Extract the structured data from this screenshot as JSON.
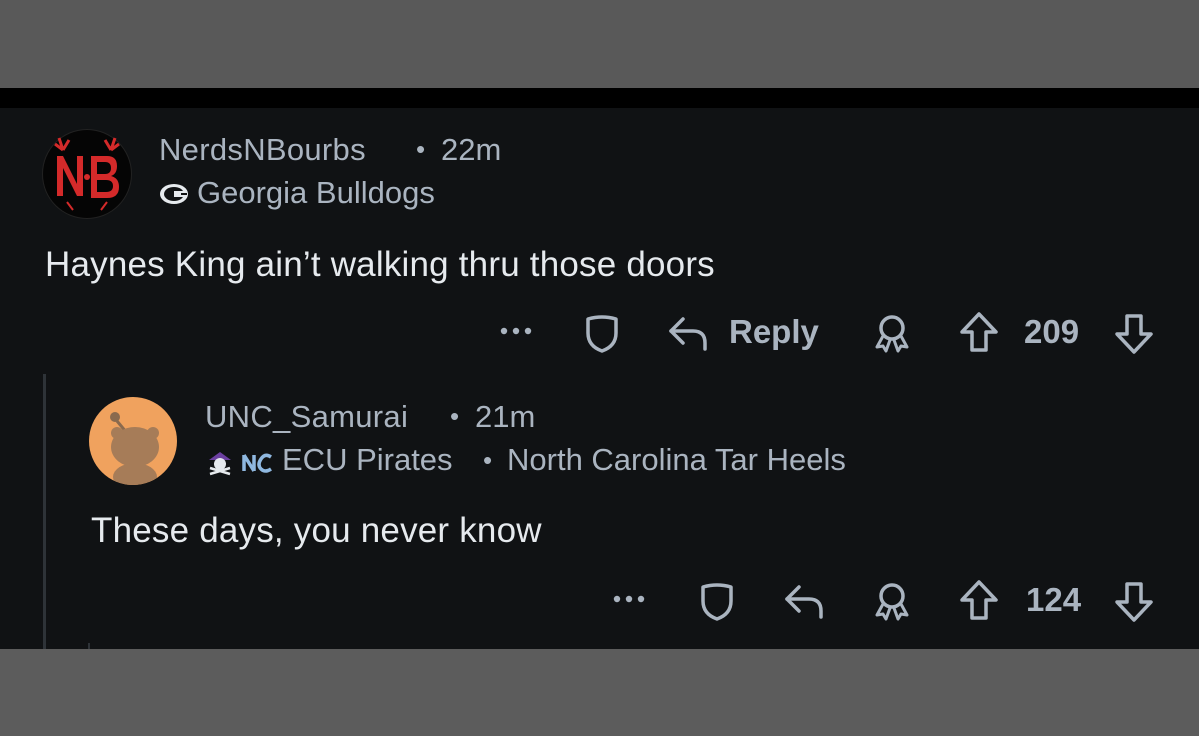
{
  "comments": [
    {
      "username": "NerdsNBourbs",
      "separator": "•",
      "time": "22m",
      "flair": "Georgia Bulldogs",
      "avatar_text": "N•B",
      "body": "Haynes King ain’t walking thru those doors",
      "actions": {
        "more_icon": "more-dots-icon",
        "save_icon": "shield-icon",
        "reply_label": "Reply",
        "award_icon": "award-icon",
        "upvote_icon": "upvote-arrow-icon",
        "score": "209",
        "downvote_icon": "downvote-arrow-icon"
      }
    },
    {
      "username": "UNC_Samurai",
      "separator": "•",
      "time": "21m",
      "flair_primary": "ECU Pirates",
      "flair_separator": "•",
      "flair_secondary": "North Carolina Tar Heels",
      "body": "These days, you never know",
      "actions": {
        "more_icon": "more-dots-icon",
        "save_icon": "shield-icon",
        "reply_icon": "reply-arrow-icon",
        "award_icon": "award-icon",
        "upvote_icon": "upvote-arrow-icon",
        "score": "124",
        "downvote_icon": "downvote-arrow-icon"
      }
    }
  ],
  "colors": {
    "panel_bg": "#101214",
    "meta_text": "#aab4c0",
    "body_text": "#e6eaee",
    "avatar2_bg": "#f0a25e",
    "avatar1_accent": "#d42a2a"
  }
}
